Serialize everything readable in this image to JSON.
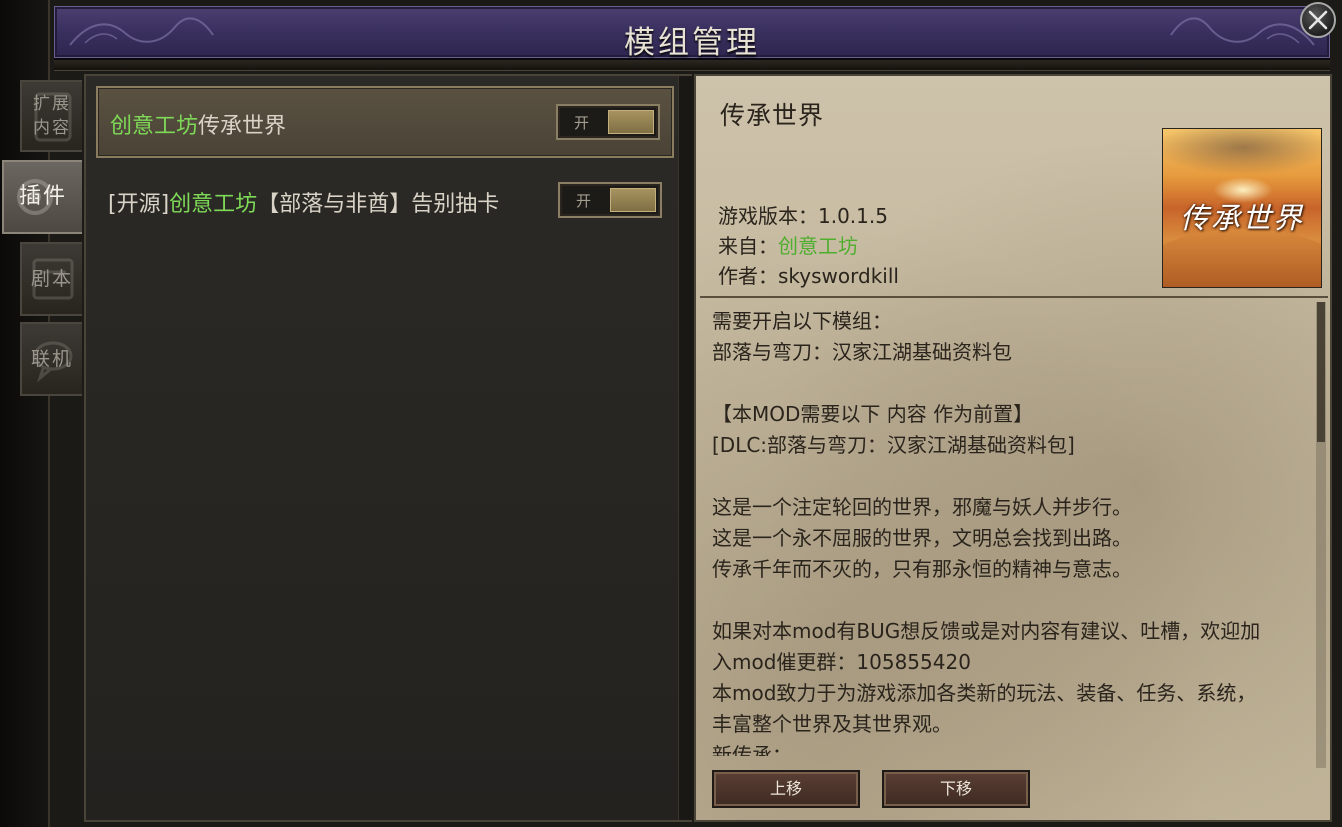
{
  "window": {
    "title": "模组管理"
  },
  "side_tabs": [
    {
      "label_line1": "扩展",
      "label_line2": "内容",
      "active": false
    },
    {
      "label": "插件",
      "active": true
    },
    {
      "label": "剧本",
      "active": false
    },
    {
      "label": "联机",
      "active": false
    }
  ],
  "mod_list": [
    {
      "prefix": "",
      "source": "创意工坊",
      "name": "传承世界",
      "toggle_label": "开",
      "enabled": true,
      "selected": true
    },
    {
      "prefix": "[开源]",
      "source": "创意工坊",
      "name": "【部落与非酋】告别抽卡",
      "toggle_label": "开",
      "enabled": true,
      "selected": false
    }
  ],
  "detail": {
    "title": "传承世界",
    "game_version_label": "游戏版本：",
    "game_version": "1.0.1.5",
    "source_label": "来自：",
    "source": "创意工坊",
    "author_label": "作者：",
    "author": "skyswordkill",
    "thumbnail_text": "传承世界",
    "description_lines": [
      "需要开启以下模组：",
      "部落与弯刀：汉家江湖基础资料包",
      "",
      "【本MOD需要以下 内容 作为前置】",
      "[DLC:部落与弯刀：汉家江湖基础资料包]",
      "",
      "这是一个注定轮回的世界，邪魔与妖人并步行。",
      "这是一个永不屈服的世界，文明总会找到出路。",
      "传承千年而不灭的，只有那永恒的精神与意志。",
      "",
      "如果对本mod有BUG想反馈或是对内容有建议、吐槽，欢迎加",
      "入mod催更群：105855420",
      "本mod致力于为游戏添加各类新的玩法、装备、任务、系统，",
      "丰富整个世界及其世界观。",
      "新传承："
    ],
    "move_up_label": "上移",
    "move_down_label": "下移"
  },
  "colors": {
    "workshop_green": "#7ed957",
    "title_bar": "#3b3160",
    "parchment": "#c5b99f"
  }
}
